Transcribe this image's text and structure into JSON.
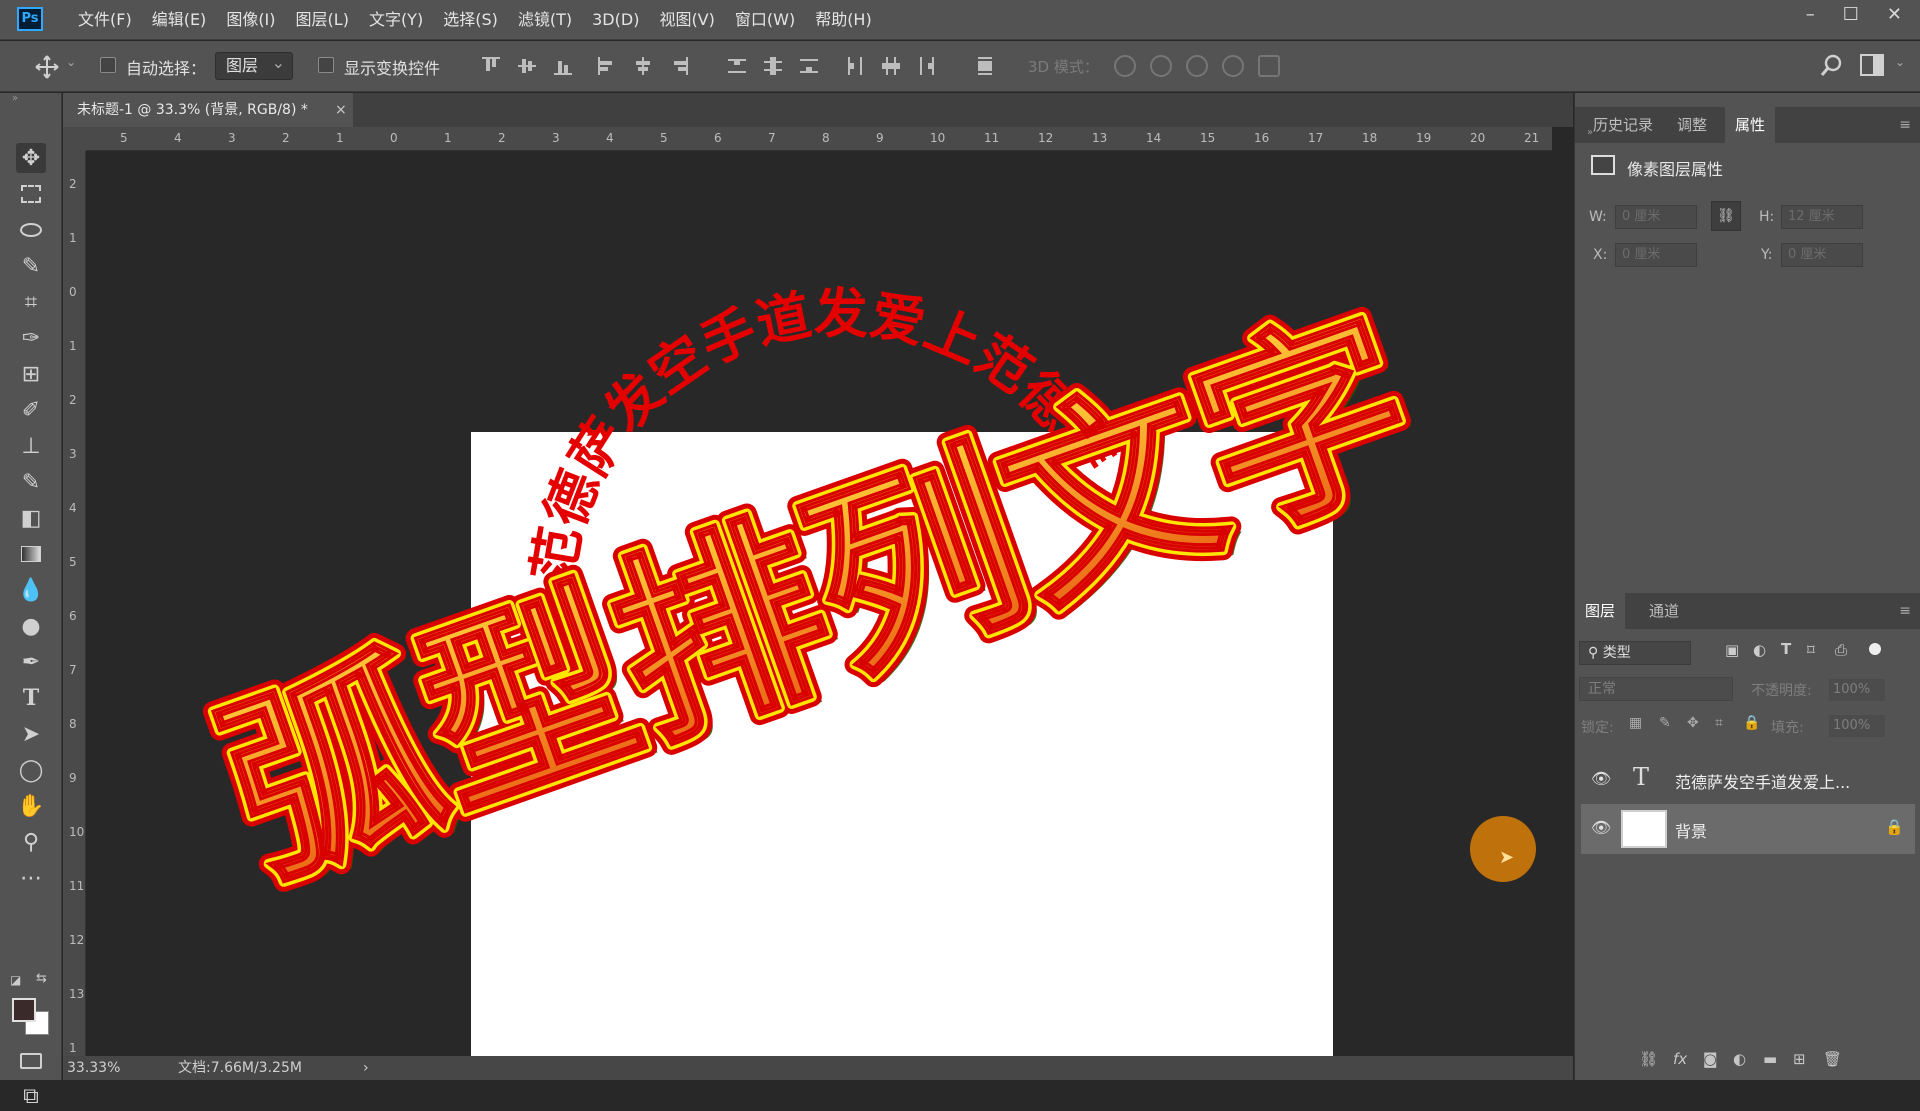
{
  "app": {
    "logo": "Ps"
  },
  "menu": [
    "文件(F)",
    "编辑(E)",
    "图像(I)",
    "图层(L)",
    "文字(Y)",
    "选择(S)",
    "滤镜(T)",
    "3D(D)",
    "视图(V)",
    "窗口(W)",
    "帮助(H)"
  ],
  "window_controls": {
    "minimize": "–",
    "maximize": "☐",
    "close": "✕"
  },
  "options": {
    "auto_select_label": "自动选择：",
    "layer_select_value": "图层",
    "show_transform_label": "显示变换控件",
    "mode3d_label": "3D 模式："
  },
  "document": {
    "tab_title": "未标题-1 @ 33.3% (背景, RGB/8) *",
    "tab_close": "×",
    "zoom": "33.33%",
    "doc_info": "文档:7.66M/3.25M",
    "status_arrow": "›"
  },
  "rulers": {
    "top": [
      "5",
      "4",
      "3",
      "2",
      "1",
      "0",
      "1",
      "2",
      "3",
      "4",
      "5",
      "6",
      "7",
      "8",
      "9",
      "10",
      "11",
      "12",
      "13",
      "14",
      "15",
      "16",
      "17",
      "18",
      "19",
      "20",
      "21"
    ],
    "left": [
      "2",
      "1",
      "0",
      "1",
      "2",
      "3",
      "4",
      "5",
      "6",
      "7",
      "8",
      "9",
      "10",
      "11",
      "12",
      "13",
      "1"
    ]
  },
  "artwork": {
    "big_title": "弧型排列文字",
    "arc_text": "范德萨发空手道发爱上范德萨",
    "colors": {
      "outer": "#d90000",
      "fill_top": "#ffd23a",
      "fill_bottom": "#e85a12",
      "arc_red": "#e50000",
      "shadow": "#1d5a00"
    }
  },
  "panel_top": {
    "tabs": [
      "历史记录",
      "调整",
      "属性"
    ],
    "active_tab": "属性",
    "title": "像素图层属性",
    "w_label": "W:",
    "w_value": "0 厘米",
    "h_label": "H:",
    "h_value": "12 厘米",
    "x_label": "X:",
    "x_value": "0 厘米",
    "y_label": "Y:",
    "y_value": "0 厘米"
  },
  "layers_panel": {
    "tabs": [
      "图层",
      "通道"
    ],
    "active_tab": "图层",
    "filter_label": "类型",
    "blend_mode": "正常",
    "opacity_label": "不透明度:",
    "opacity_value": "100%",
    "lock_label": "锁定:",
    "fill_label": "填充:",
    "fill_value": "100%",
    "layers": [
      {
        "name": "范德萨发空手道发爱上...",
        "type": "text"
      },
      {
        "name": "背景",
        "type": "background",
        "locked": true
      }
    ]
  }
}
